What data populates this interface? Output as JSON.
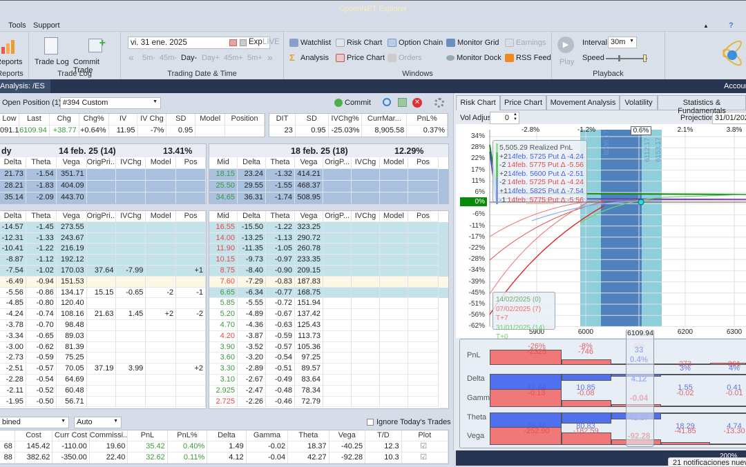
{
  "app": {
    "title": "OptionNET Explorer"
  },
  "menu": {
    "items": [
      "Tools",
      "Support"
    ],
    "collapse": "▲",
    "help": "?"
  },
  "ribbon": {
    "reports": {
      "button": "Reports",
      "group": "Reports"
    },
    "trade_log": {
      "trade_log": "Trade Log",
      "commit_trade": "Commit Trade",
      "group": "Trade Log"
    },
    "trading_date": {
      "date": "vi. 31 ene. 2025",
      "exp": "Exp",
      "live": "LIVE",
      "steps": [
        "5m-",
        "45m-",
        "Day-",
        "Day+",
        "45m+",
        "5m+"
      ],
      "group": "Trading Date & Time"
    },
    "windows": {
      "items": [
        "Watchlist",
        "Risk Chart",
        "Option Chain",
        "Monitor Grid",
        "Earnings",
        "Analysis",
        "Price Chart",
        "Orders",
        "Monitor Dock",
        "RSS Feed"
      ],
      "group": "Windows"
    },
    "playback": {
      "play": "Play",
      "interval_label": "Interval",
      "interval": "30m",
      "speed_label": "Speed",
      "group": "Playback"
    }
  },
  "nav": {
    "tab": "Analysis: /ES",
    "account": "Accoun"
  },
  "position": {
    "label": "Open Position (1)",
    "selected": "#394 Custom",
    "commit": "Commit"
  },
  "summary": {
    "left_headers": [
      "Low",
      "Last",
      "Chg",
      "Chg%",
      "IV",
      "IV Chg",
      "SD",
      "Model",
      "Position"
    ],
    "left_values": [
      "091.10",
      "6109.94",
      "+38.77",
      "+0.64%",
      "11.95",
      "-7%",
      "0.95",
      "",
      ""
    ],
    "right_headers": [
      "DIT",
      "SD",
      "IVChg%",
      "CurrMar...",
      "PnL%"
    ],
    "right_values": [
      "23",
      "0.95",
      "-25.03%",
      "8,905.58",
      "0.37%"
    ]
  },
  "expiry_left": {
    "partial": "dy",
    "title": "14 feb. 25 (14)",
    "iv": "13.41%",
    "headers": [
      "Delta",
      "Theta",
      "Vega",
      "OrigPri...",
      "IVChg",
      "Model",
      "Pos"
    ],
    "rows": [
      [
        "21.73",
        "-1.54",
        "351.71",
        "",
        "",
        "",
        ""
      ],
      [
        "28.21",
        "-1.83",
        "404.09",
        "",
        "",
        "",
        ""
      ],
      [
        "35.14",
        "-2.09",
        "443.70",
        "",
        "",
        "",
        ""
      ]
    ]
  },
  "expiry_right": {
    "title": "18 feb. 25 (18)",
    "iv": "12.29%",
    "headers": [
      "Mid",
      "Delta",
      "Theta",
      "Vega",
      "OrigP...",
      "IVChg",
      "Model",
      "Pos"
    ],
    "rows": [
      [
        "18.15",
        "23.24",
        "-1.32",
        "414.21",
        "",
        "",
        "",
        ""
      ],
      [
        "25.50",
        "29.55",
        "-1.55",
        "468.37",
        "",
        "",
        "",
        ""
      ],
      [
        "34.65",
        "36.31",
        "-1.74",
        "508.95",
        "",
        "",
        "",
        ""
      ]
    ]
  },
  "chain_left": {
    "headers": [
      "Delta",
      "Theta",
      "Vega",
      "OrigPri...",
      "IVChg",
      "Model",
      "Pos"
    ],
    "rows": [
      [
        "-14.57",
        "-1.45",
        "273.55",
        "",
        "",
        "",
        ""
      ],
      [
        "-12.31",
        "-1.33",
        "243.67",
        "",
        "",
        "",
        ""
      ],
      [
        "-10.41",
        "-1.22",
        "216.19",
        "",
        "",
        "",
        ""
      ],
      [
        "-8.87",
        "-1.12",
        "192.12",
        "",
        "",
        "",
        ""
      ],
      [
        "-7.54",
        "-1.02",
        "170.03",
        "37.64",
        "-7.99",
        "",
        "+1"
      ],
      [
        "-6.49",
        "-0.94",
        "151.53",
        "",
        "",
        "",
        ""
      ],
      [
        "-5.56",
        "-0.86",
        "134.17",
        "15.15",
        "-0.65",
        "-2",
        "-1"
      ],
      [
        "-4.85",
        "-0.80",
        "120.40",
        "",
        "",
        "",
        ""
      ],
      [
        "-4.24",
        "-0.74",
        "108.16",
        "21.63",
        "1.45",
        "+2",
        "-2"
      ],
      [
        "-3.78",
        "-0.70",
        "98.48",
        "",
        "",
        "",
        ""
      ],
      [
        "-3.34",
        "-0.65",
        "89.03",
        "",
        "",
        "",
        ""
      ],
      [
        "-3.00",
        "-0.62",
        "81.39",
        "",
        "",
        "",
        ""
      ],
      [
        "-2.73",
        "-0.59",
        "75.25",
        "",
        "",
        "",
        ""
      ],
      [
        "-2.51",
        "-0.57",
        "70.05",
        "37.19",
        "3.99",
        "",
        "+2"
      ],
      [
        "-2.28",
        "-0.54",
        "64.69",
        "",
        "",
        "",
        ""
      ],
      [
        "-2.11",
        "-0.52",
        "60.48",
        "",
        "",
        "",
        ""
      ],
      [
        "-1.95",
        "-0.50",
        "56.71",
        "",
        "",
        "",
        ""
      ]
    ]
  },
  "chain_right": {
    "headers": [
      "Mid",
      "Delta",
      "Theta",
      "Vega",
      "OrigP...",
      "IVChg",
      "Model",
      "Pos"
    ],
    "rows": [
      [
        "16.55",
        "-15.50",
        "-1.22",
        "323.25"
      ],
      [
        "14.00",
        "-13.25",
        "-1.13",
        "290.72"
      ],
      [
        "11.90",
        "-11.35",
        "-1.05",
        "260.78"
      ],
      [
        "10.15",
        "-9.73",
        "-0.97",
        "233.35"
      ],
      [
        "8.75",
        "-8.40",
        "-0.90",
        "209.15"
      ],
      [
        "7.60",
        "-7.29",
        "-0.83",
        "187.83"
      ],
      [
        "6.65",
        "-6.34",
        "-0.77",
        "168.75"
      ],
      [
        "5.85",
        "-5.55",
        "-0.72",
        "151.94"
      ],
      [
        "5.20",
        "-4.89",
        "-0.67",
        "137.42"
      ],
      [
        "4.70",
        "-4.36",
        "-0.63",
        "125.43"
      ],
      [
        "4.20",
        "-3.87",
        "-0.59",
        "113.73"
      ],
      [
        "3.90",
        "-3.52",
        "-0.57",
        "105.36"
      ],
      [
        "3.60",
        "-3.20",
        "-0.54",
        "97.25"
      ],
      [
        "3.30",
        "-2.89",
        "-0.51",
        "89.57"
      ],
      [
        "3.10",
        "-2.67",
        "-0.49",
        "83.64"
      ],
      [
        "2.925",
        "-2.47",
        "-0.48",
        "78.34"
      ],
      [
        "2.725",
        "-2.26",
        "-0.46",
        "72.79"
      ]
    ],
    "mid_colors": [
      "red",
      "red",
      "red",
      "red",
      "red",
      "red",
      "grn",
      "grn",
      "grn",
      "grn",
      "red",
      "grn",
      "grn",
      "grn",
      "grn",
      "grn",
      "red"
    ]
  },
  "bottom": {
    "group_select": "bined",
    "mode_select": "Auto",
    "ignore_label": "Ignore Today's Trades",
    "headers": [
      "",
      "Cost",
      "Curr Cost",
      "Commissi...",
      "PnL",
      "PnL%",
      "Delta",
      "Gamma",
      "Theta",
      "Vega",
      "T/D",
      "Plot"
    ],
    "rows": [
      [
        "68",
        "145.42",
        "-110.00",
        "19.60",
        "35.42",
        "0.40%",
        "1.49",
        "-0.02",
        "18.37",
        "-40.25",
        "12.3",
        "☑"
      ],
      [
        "88",
        "382.62",
        "-350.00",
        "22.40",
        "32.62",
        "0.11%",
        "4.12",
        "-0.04",
        "42.27",
        "-92.28",
        "10.3",
        "☑"
      ]
    ]
  },
  "right_tabs": [
    "Risk Chart",
    "Price Chart",
    "Movement Analysis",
    "Volatility",
    "Statistics & Fundamentals"
  ],
  "risk": {
    "vol_adjust_label": "Vol Adjust",
    "vol_adjust": "0",
    "projection_label": "Projection",
    "projection": "31/01/202",
    "top_ticks": [
      "-2.8%",
      "-1.2%",
      "0.6%",
      "2.1%",
      "3.8%"
    ],
    "y_ticks": [
      "34%",
      "28%",
      "22%",
      "17%",
      "11%",
      "6%",
      "0%",
      "-6%",
      "-11%",
      "-17%",
      "-22%",
      "-28%",
      "-34%",
      "-39%",
      "-45%",
      "-51%",
      "-56%",
      "-62%"
    ],
    "x_ticks": [
      "5900",
      "6000",
      "6109.94",
      "6200",
      "6300"
    ],
    "band_labels": [
      "6030.17",
      "6112.17",
      "6153.17"
    ],
    "tooltip": {
      "title": "5,505.29 Realized PnL",
      "lines": [
        {
          "qty": "+2",
          "leg": "14feb. 5725 Put Δ",
          "val": "-4.24",
          "color": "#4a5de8"
        },
        {
          "qty": "-2",
          "leg": "14feb. 5775 Put Δ",
          "val": "-5.56",
          "color": "#e34a4a"
        },
        {
          "qty": "+2",
          "leg": "14feb. 5600 Put Δ",
          "val": "-2.51",
          "color": "#4a5de8"
        },
        {
          "qty": "-2",
          "leg": "14feb. 5725 Put Δ",
          "val": "-4.24",
          "color": "#e34a4a"
        },
        {
          "qty": "+1",
          "leg": "14feb. 5825 Put Δ",
          "val": "-7.54",
          "color": "#4a5de8"
        },
        {
          "qty": "-1",
          "leg": "14feb. 5775 Put Δ",
          "val": "-5.56",
          "color": "#e34a4a"
        }
      ]
    },
    "legend": [
      {
        "text": "14/02/2025 (0)",
        "color": "#6db06d"
      },
      {
        "text": "07/02/2025 (7) T+7",
        "color": "#f07070"
      },
      {
        "text": "31/01/2025 (14) T+0",
        "color": "#6fd06f"
      }
    ]
  },
  "greeks": {
    "labels": [
      "PnL",
      "Delta",
      "Gamma",
      "Theta",
      "Vega"
    ],
    "pnl_pct": [
      "-26%",
      "-8%",
      "0%",
      "",
      "3%",
      "4%"
    ],
    "pnl": [
      "-2325",
      "-746",
      "",
      "",
      "273",
      "361"
    ],
    "delta": [
      "21.44",
      "10.85",
      "",
      "",
      "1.55",
      "0.41"
    ],
    "gamma": [
      "-0.13",
      "-0.08",
      "",
      "",
      "-0.02",
      "-0.01"
    ],
    "theta": [
      "95.94",
      "80.83",
      "",
      "",
      "18.29",
      "4.74"
    ],
    "vega": [
      "-252.90",
      "-182.59",
      "",
      "",
      "-41.85",
      "-13.30"
    ],
    "current": {
      "pnl": "33",
      "pnl_pct": "0.4%",
      "delta": "4.12",
      "gamma": "-0.04",
      "theta": "42.27",
      "vega": "-92.28"
    }
  },
  "status": {
    "zoom": "200%",
    "notification": "21 notificaciones nuevas"
  }
}
